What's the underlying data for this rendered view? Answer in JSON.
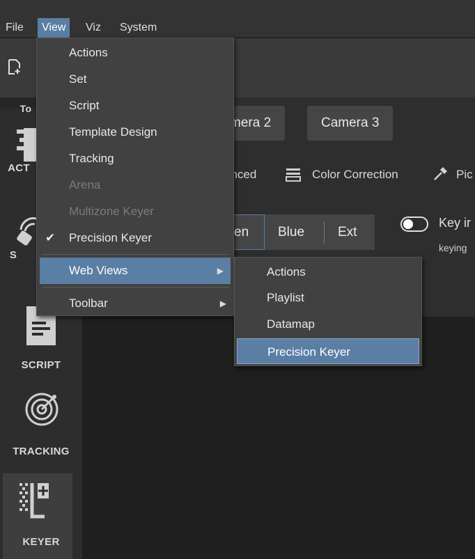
{
  "menubar": {
    "items": [
      {
        "label": "File",
        "active": false
      },
      {
        "label": "View",
        "active": true
      },
      {
        "label": "Viz",
        "active": false
      },
      {
        "label": "System",
        "active": false
      }
    ]
  },
  "sidebar": {
    "partial_top_label": "To",
    "items": [
      {
        "label": "ACT",
        "icon": "actions-icon"
      },
      {
        "label": "S",
        "icon": "set-icon"
      },
      {
        "label": "SCRIPT",
        "icon": "script-icon"
      },
      {
        "label": "TRACKING",
        "icon": "tracking-icon"
      },
      {
        "label": "KEYER",
        "icon": "keyer-icon",
        "selected": true
      }
    ]
  },
  "cameras": [
    {
      "label": "mera 2"
    },
    {
      "label": "Camera 3"
    }
  ],
  "tabs": [
    {
      "label": "anced"
    },
    {
      "label": "Color Correction",
      "icon": "color-correction-icon"
    },
    {
      "label": "Pic",
      "icon": "eyedropper-icon"
    }
  ],
  "key_segments": [
    "en",
    "Blue",
    "Ext"
  ],
  "key_toggle": {
    "label": "Key ir",
    "sublabel": "keying",
    "on": false
  },
  "view_menu": {
    "items": [
      {
        "label": "Actions",
        "disabled": false
      },
      {
        "label": "Set",
        "disabled": false
      },
      {
        "label": "Script",
        "disabled": false
      },
      {
        "label": "Template Design",
        "disabled": false
      },
      {
        "label": "Tracking",
        "disabled": false
      },
      {
        "label": "Arena",
        "disabled": true
      },
      {
        "label": "Multizone Keyer",
        "disabled": true
      },
      {
        "label": "Precision Keyer",
        "checked": true
      },
      {
        "label": "Web Views",
        "submenu": true,
        "highlight": true
      },
      {
        "label": "Toolbar",
        "submenu": true
      }
    ]
  },
  "web_views_submenu": {
    "items": [
      {
        "label": "Actions"
      },
      {
        "label": "Playlist"
      },
      {
        "label": "Datamap"
      },
      {
        "label": "Precision Keyer",
        "highlight": true
      }
    ]
  },
  "colors": {
    "highlight": "#5b7ea5",
    "menu_bg": "#414141",
    "app_bg": "#1e1e1e"
  }
}
